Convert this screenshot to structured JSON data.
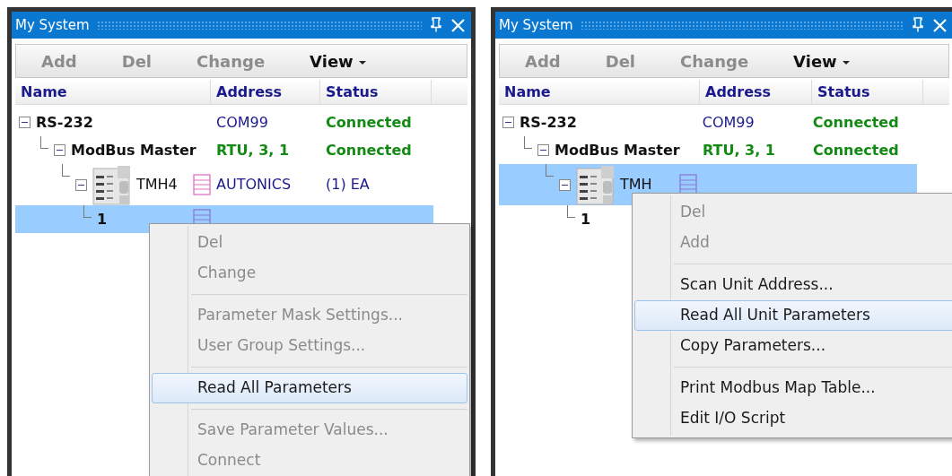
{
  "panels": [
    {
      "title": "My System",
      "toolbar": [
        {
          "label": "Add",
          "disabled": true,
          "kind": "button"
        },
        {
          "label": "Del",
          "disabled": true,
          "kind": "button"
        },
        {
          "label": "Change",
          "disabled": true,
          "kind": "button"
        },
        {
          "label": "View",
          "disabled": false,
          "kind": "dropdown"
        }
      ],
      "columns": [
        "Name",
        "Address",
        "Status"
      ],
      "tree": [
        {
          "name": "RS-232",
          "kind": "port",
          "expanded": true,
          "selected": false,
          "address": {
            "text": "COM99",
            "color": "#1a1a8c"
          },
          "status": {
            "text": "Connected",
            "color": "#138a13"
          },
          "children": [
            {
              "name": "ModBus Master",
              "kind": "master",
              "expanded": true,
              "selected": false,
              "address": {
                "text": "RTU, 3, 1",
                "color": "#138a13"
              },
              "status": {
                "text": "Connected",
                "color": "#138a13"
              },
              "children": [
                {
                  "name": "TMH4",
                  "kind": "device",
                  "expanded": true,
                  "selected": false,
                  "list_icon": true,
                  "address": {
                    "text": "AUTONICS",
                    "color": "#1a1a8c"
                  },
                  "status": {
                    "text": "(1) EA",
                    "color": "#1a1a8c"
                  },
                  "children": [
                    {
                      "name": "1",
                      "kind": "unit",
                      "selected": true,
                      "list_icon": true
                    }
                  ]
                }
              ]
            }
          ]
        }
      ],
      "context_menu": {
        "groups": [
          [
            {
              "label": "Del",
              "disabled": true,
              "selected": false
            },
            {
              "label": "Change",
              "disabled": true,
              "selected": false
            }
          ],
          [
            {
              "label": "Parameter Mask Settings...",
              "disabled": true,
              "selected": false
            },
            {
              "label": "User Group Settings...",
              "disabled": true,
              "selected": false
            }
          ],
          [
            {
              "label": "Read All Parameters",
              "disabled": false,
              "selected": true
            }
          ],
          [
            {
              "label": "Save Parameter Values...",
              "disabled": true,
              "selected": false
            },
            {
              "label": "Connect",
              "disabled": true,
              "selected": false
            }
          ]
        ]
      }
    },
    {
      "title": "My System",
      "toolbar": [
        {
          "label": "Add",
          "disabled": true,
          "kind": "button"
        },
        {
          "label": "Del",
          "disabled": true,
          "kind": "button"
        },
        {
          "label": "Change",
          "disabled": true,
          "kind": "button"
        },
        {
          "label": "View",
          "disabled": false,
          "kind": "dropdown"
        }
      ],
      "columns": [
        "Name",
        "Address",
        "Status"
      ],
      "tree": [
        {
          "name": "RS-232",
          "kind": "port",
          "expanded": true,
          "selected": false,
          "address": {
            "text": "COM99",
            "color": "#1a1a8c"
          },
          "status": {
            "text": "Connected",
            "color": "#138a13"
          },
          "children": [
            {
              "name": "ModBus Master",
              "kind": "master",
              "expanded": true,
              "selected": false,
              "address": {
                "text": "RTU, 3, 1",
                "color": "#138a13"
              },
              "status": {
                "text": "Connected",
                "color": "#138a13"
              },
              "children": [
                {
                  "name": "TMH",
                  "kind": "device",
                  "expanded": true,
                  "selected": true,
                  "list_icon": true,
                  "children": [
                    {
                      "name": "1",
                      "kind": "unit",
                      "selected": false
                    }
                  ]
                }
              ]
            }
          ]
        }
      ],
      "context_menu": {
        "groups": [
          [
            {
              "label": "Del",
              "disabled": true,
              "selected": false
            },
            {
              "label": "Add",
              "disabled": true,
              "selected": false
            }
          ],
          [
            {
              "label": "Scan Unit Address...",
              "disabled": false,
              "selected": false
            },
            {
              "label": "Read All Unit Parameters",
              "disabled": false,
              "selected": true
            },
            {
              "label": "Copy Parameters...",
              "disabled": false,
              "selected": false
            }
          ],
          [
            {
              "label": "Print Modbus Map Table...",
              "disabled": false,
              "selected": false
            },
            {
              "label": "Edit I/O Script",
              "disabled": false,
              "selected": false
            }
          ]
        ]
      }
    }
  ]
}
